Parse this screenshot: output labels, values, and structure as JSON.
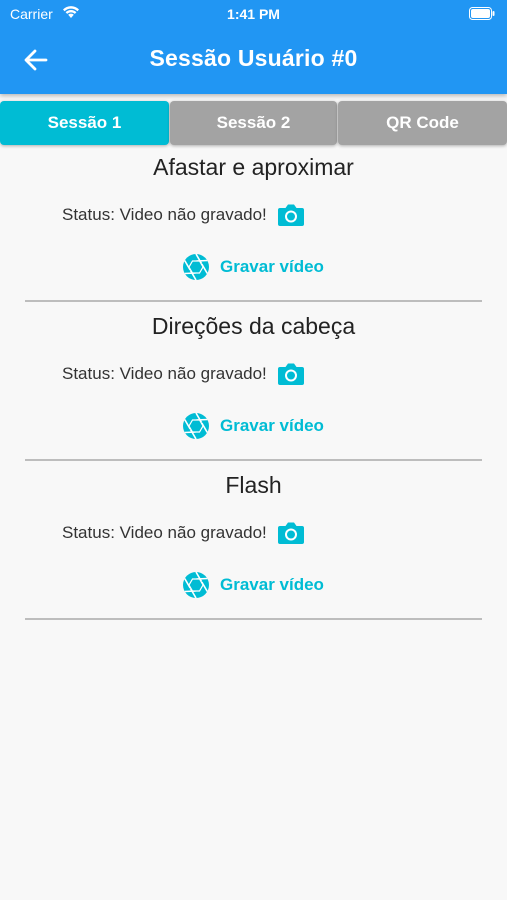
{
  "status_bar": {
    "carrier": "Carrier",
    "time": "1:41 PM"
  },
  "appbar": {
    "title": "Sessão Usuário #0",
    "back_icon": "arrow-left-icon"
  },
  "tabs": [
    {
      "label": "Sessão 1",
      "active": true
    },
    {
      "label": "Sessão 2",
      "active": false
    },
    {
      "label": "QR Code",
      "active": false
    }
  ],
  "sections": [
    {
      "title": "Afastar e aproximar",
      "status": "Status: Video não gravado!",
      "record_label": "Gravar vídeo"
    },
    {
      "title": "Direções da cabeça",
      "status": "Status: Video não gravado!",
      "record_label": "Gravar vídeo"
    },
    {
      "title": "Flash",
      "status": "Status: Video não gravado!",
      "record_label": "Gravar vídeo"
    }
  ],
  "colors": {
    "appbar": "#2196f3",
    "accent": "#00bcd4",
    "tab_inactive": "#a3a3a3"
  }
}
